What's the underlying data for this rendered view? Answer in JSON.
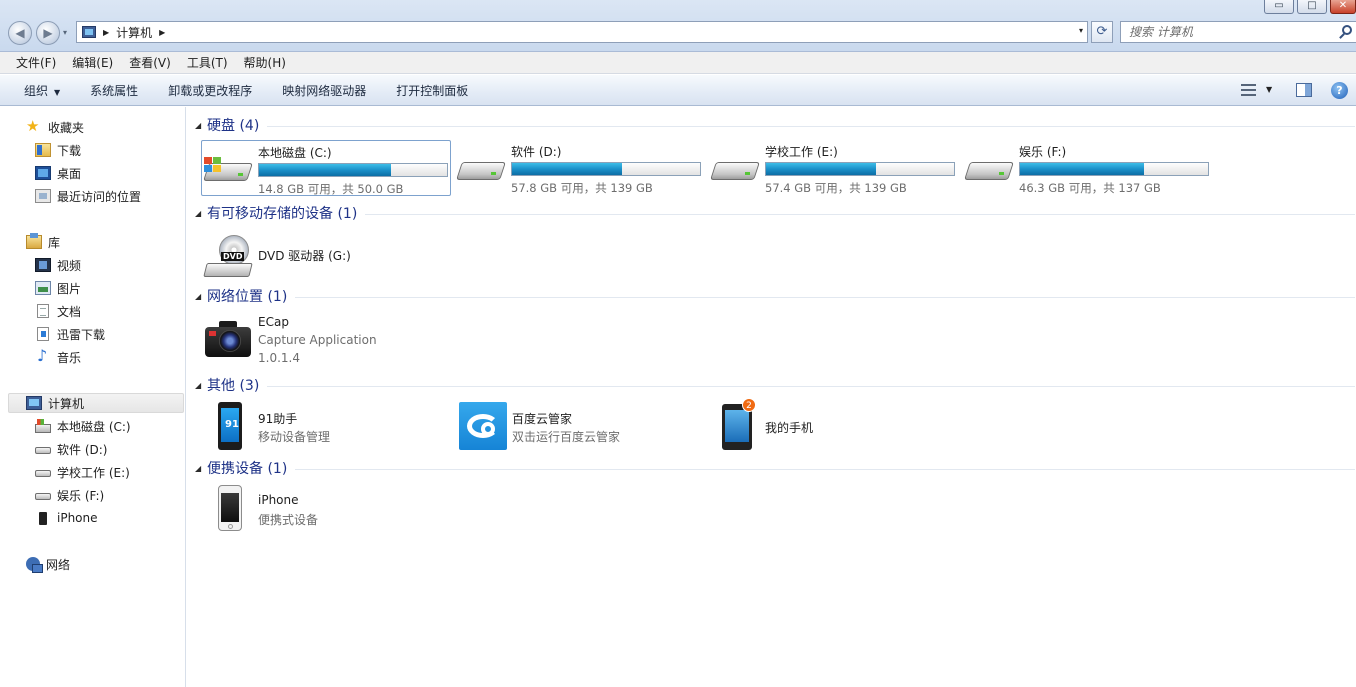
{
  "window": {
    "minimize": "▭",
    "maximize": "□",
    "close": "✕"
  },
  "nav": {
    "back": "◀",
    "forward": "▶",
    "dropdown": "▾"
  },
  "address": {
    "path": [
      "计算机"
    ],
    "dropdown": "▾",
    "refresh": "⟳"
  },
  "search": {
    "placeholder": "搜索 计算机"
  },
  "menu": [
    "文件(F)",
    "编辑(E)",
    "查看(V)",
    "工具(T)",
    "帮助(H)"
  ],
  "commands": {
    "organize": "组织",
    "system_properties": "系统属性",
    "uninstall": "卸载或更改程序",
    "map_drive": "映射网络驱动器",
    "control_panel": "打开控制面板"
  },
  "sidebar": {
    "favorites": "收藏夹",
    "downloads": "下载",
    "desktop": "桌面",
    "recent": "最近访问的位置",
    "libraries": "库",
    "videos": "视频",
    "pictures": "图片",
    "documents": "文档",
    "thunder": "迅雷下载",
    "music": "音乐",
    "computer": "计算机",
    "drive_c": "本地磁盘 (C:)",
    "drive_d": "软件 (D:)",
    "drive_e": "学校工作 (E:)",
    "drive_f": "娱乐 (F:)",
    "iphone": "iPhone",
    "network": "网络"
  },
  "groups": {
    "hard_disks": "硬盘 (4)",
    "removable": "有可移动存储的设备 (1)",
    "network": "网络位置 (1)",
    "other": "其他 (3)",
    "portable": "便携设备 (1)"
  },
  "drives": [
    {
      "name": "本地磁盘 (C:)",
      "free": "14.8 GB 可用，共 50.0 GB",
      "used_fraction": 0.704,
      "system": true
    },
    {
      "name": "软件 (D:)",
      "free": "57.8 GB 可用，共 139 GB",
      "used_fraction": 0.584,
      "system": false
    },
    {
      "name": "学校工作 (E:)",
      "free": "57.4 GB 可用，共 139 GB",
      "used_fraction": 0.587,
      "system": false
    },
    {
      "name": "娱乐 (F:)",
      "free": "46.3 GB 可用，共 137 GB",
      "used_fraction": 0.662,
      "system": false
    }
  ],
  "dvd": {
    "name": "DVD 驱动器 (G:)",
    "label": "DVD"
  },
  "ecap": {
    "name": "ECap",
    "desc": "Capture Application",
    "version": "1.0.1.4"
  },
  "others": [
    {
      "name": "91助手",
      "desc": "移动设备管理",
      "logo": "91"
    },
    {
      "name": "百度云管家",
      "desc": "双击运行百度云管家"
    },
    {
      "name": "我的手机",
      "badge": "2"
    }
  ],
  "portable": {
    "name": "iPhone",
    "desc": "便携式设备"
  },
  "colors": {
    "group_title": "#1e3287",
    "drive_bar": "#1b90c9",
    "selection_border": "#7da2ce"
  }
}
